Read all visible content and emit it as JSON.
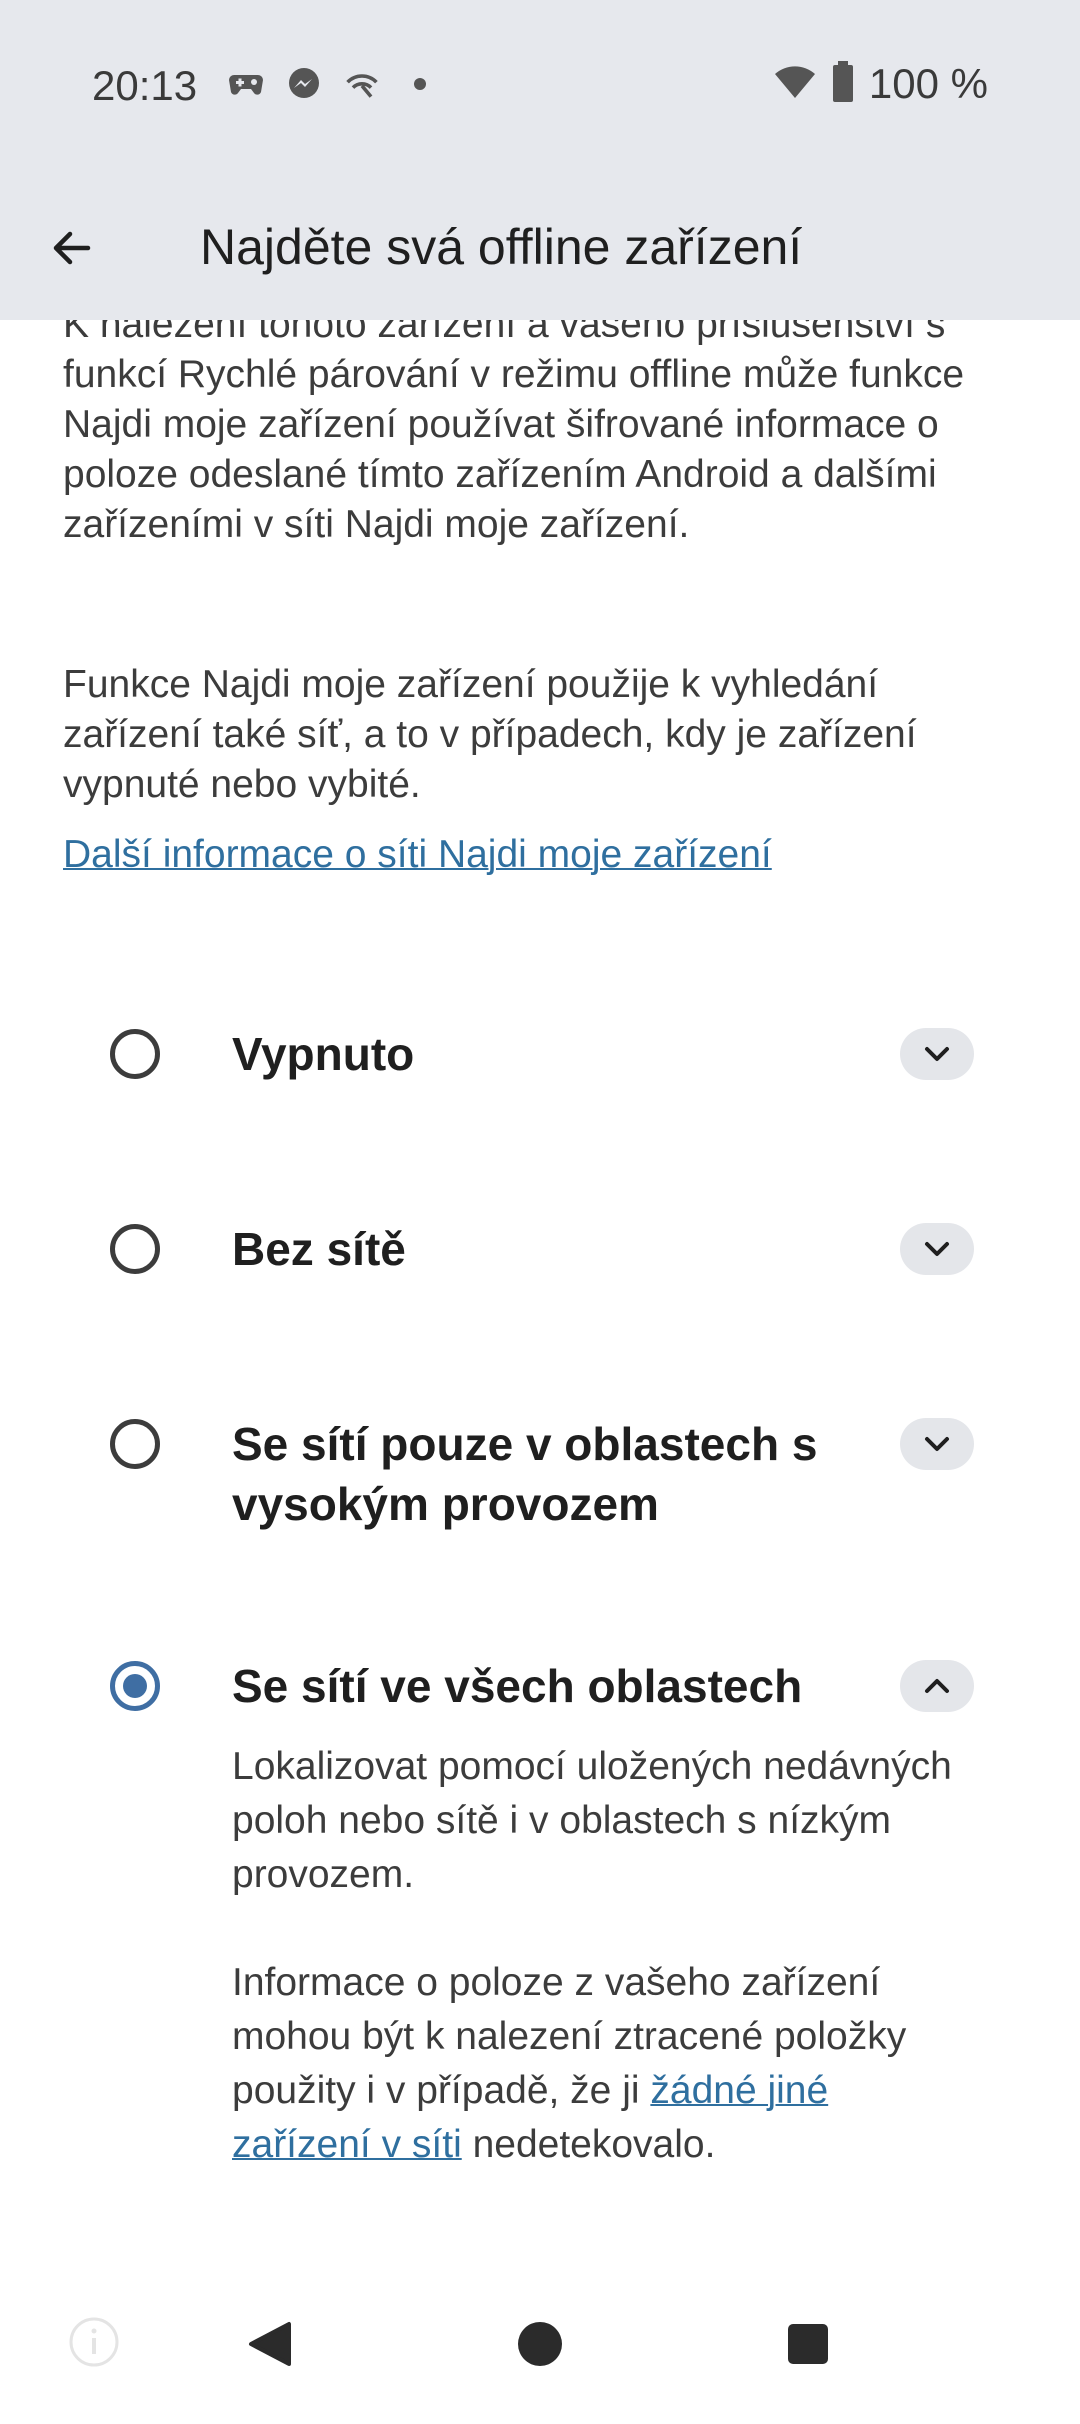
{
  "status_bar": {
    "time": "20:13",
    "battery_text": "100 %",
    "icons": [
      "game-controller-icon",
      "messenger-icon",
      "hotspot-icon",
      "dot-icon",
      "wifi-icon",
      "battery-icon"
    ]
  },
  "app_bar": {
    "title": "Najděte svá offline zařízení",
    "back_icon": "arrow-left-icon"
  },
  "content": {
    "paragraph1": "K nalezení tohoto zařízení a vašeho příslušenství s funkcí Rychlé párování v režimu offline může funkce Najdi moje zařízení používat šifrované informace o poloze odeslané tímto zařízením Android a dalšími zařízeními v síti Najdi moje zařízení.",
    "paragraph2": "Funkce Najdi moje zařízení použije k vyhledání zařízení také síť, a to v případech, kdy je zařízení vypnuté nebo vybité.",
    "more_info_link": "Další informace o síti Najdi moje zařízení"
  },
  "options": [
    {
      "label": "Vypnuto",
      "selected": false,
      "expanded": false
    },
    {
      "label": "Bez sítě",
      "selected": false,
      "expanded": false
    },
    {
      "label": "Se sítí pouze v oblastech s vysokým provozem",
      "selected": false,
      "expanded": false
    },
    {
      "label": "Se sítí ve všech oblastech",
      "selected": true,
      "expanded": true
    }
  ],
  "expanded_detail": {
    "text1": "Lokalizovat pomocí uložených nedávných poloh nebo sítě i v oblastech s nízkým provozem.",
    "text2_before": "Informace o poloze z vašeho zařízení mohou být k nalezení ztracené položky použity i v případě, že ji ",
    "text2_link": "žádné jiné zařízení v síti",
    "text2_after": " nedetekovalo."
  },
  "colors": {
    "accent": "#3f6ea3",
    "link": "#2f6f9f",
    "bar_background": "#e6e8ed"
  }
}
